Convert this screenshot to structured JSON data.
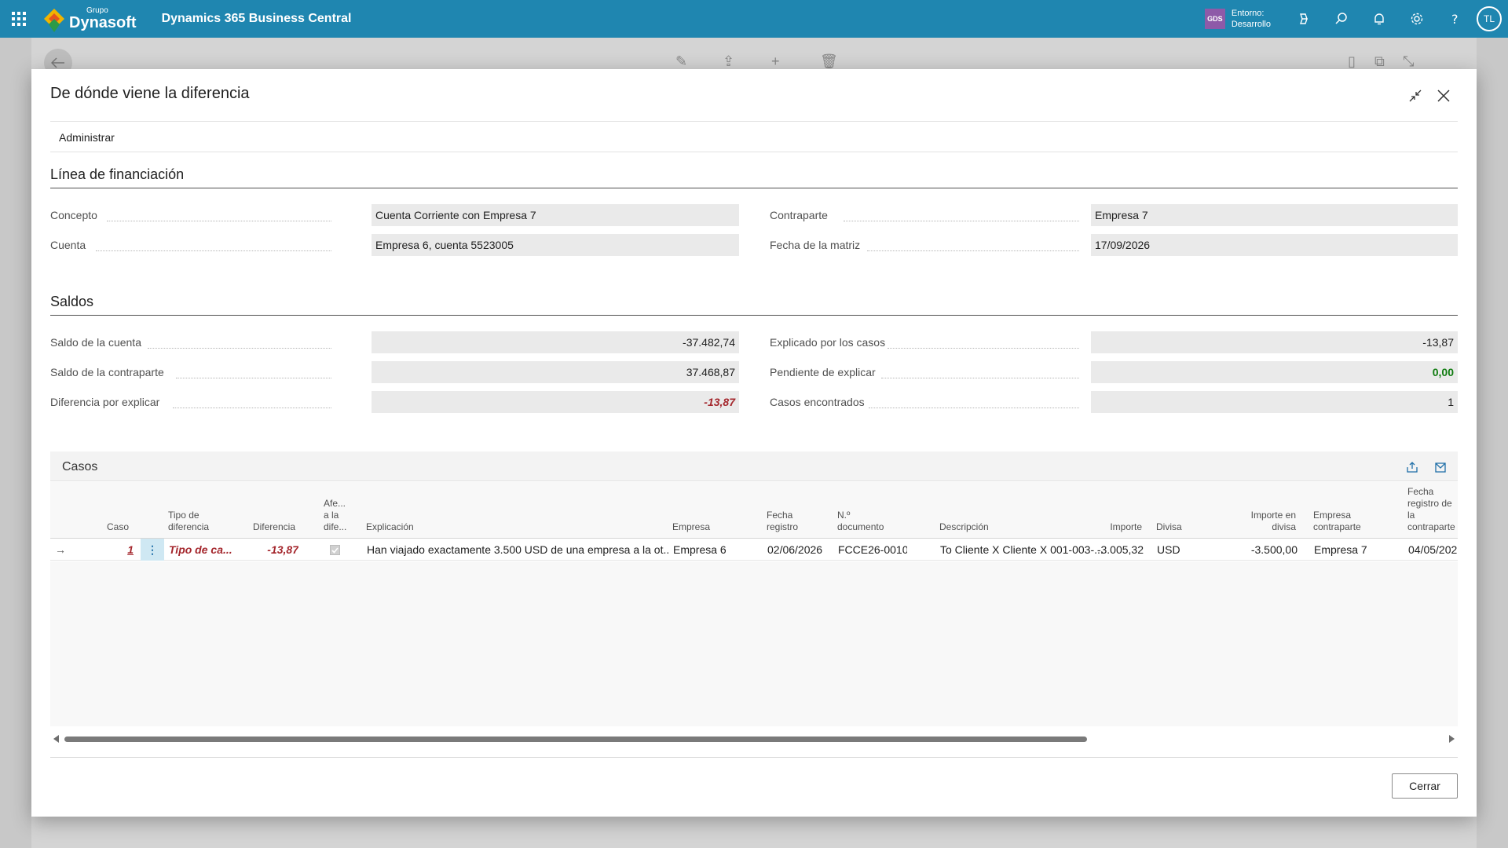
{
  "appbar": {
    "logo_small": "Grupo",
    "logo_big": "Dynasoft",
    "app_title": "Dynamics 365 Business Central",
    "env_badge": "GDS",
    "env_line1": "Entorno:",
    "env_line2": "Desarrollo",
    "avatar": "TL",
    "icons": [
      "copilot-icon",
      "search-icon",
      "bell-icon",
      "gear-icon",
      "help-icon"
    ]
  },
  "dialog": {
    "title": "De dónde viene la diferencia",
    "menu": {
      "administrar": "Administrar"
    },
    "close_button": "Cerrar"
  },
  "financiacion": {
    "title": "Línea de financiación",
    "concepto_label": "Concepto",
    "concepto_value": "Cuenta Corriente con Empresa 7",
    "cuenta_label": "Cuenta",
    "cuenta_value": "Empresa 6, cuenta 5523005",
    "contraparte_label": "Contraparte",
    "contraparte_value": "Empresa 7",
    "fecha_label": "Fecha de la matriz",
    "fecha_value": "17/09/2026"
  },
  "saldos": {
    "title": "Saldos",
    "saldo_cuenta_label": "Saldo de la cuenta",
    "saldo_cuenta_value": "-37.482,74",
    "saldo_contraparte_label": "Saldo de la contraparte",
    "saldo_contraparte_value": "37.468,87",
    "diferencia_label": "Diferencia por explicar",
    "diferencia_value": "-13,87",
    "explicado_label": "Explicado por los casos",
    "explicado_value": "-13,87",
    "pendiente_label": "Pendiente de explicar",
    "pendiente_value": "0,00",
    "casos_label": "Casos encontrados",
    "casos_value": "1"
  },
  "casos": {
    "title": "Casos",
    "columns": {
      "caso": "Caso",
      "tipo": "Tipo de diferencia",
      "diferencia": "Diferencia",
      "afecta": "Afe... a la dife...",
      "explicacion": "Explicación",
      "empresa": "Empresa",
      "fecha_registro": "Fecha registro",
      "n_documento": "N.º documento",
      "descripcion": "Descripción",
      "importe": "Importe",
      "divisa": "Divisa",
      "importe_divisa": "Importe en divisa",
      "empresa_contraparte": "Empresa contraparte",
      "fecha_contraparte": "Fecha registro de la contraparte"
    },
    "row": {
      "caso": "1",
      "tipo": "Tipo de ca...",
      "diferencia": "-13,87",
      "afecta_checked": true,
      "explicacion": "Han viajado exactamente 3.500 USD de una empresa a la ot...",
      "empresa": "Empresa 6",
      "fecha_registro": "02/06/2026",
      "n_documento": "FCCE26-0010",
      "descripcion": "To Cliente X Cliente X 001-003-...",
      "importe": "-3.005,32",
      "divisa": "USD",
      "importe_divisa": "-3.500,00",
      "empresa_contraparte": "Empresa 7",
      "fecha_contraparte": "04/05/202"
    }
  }
}
